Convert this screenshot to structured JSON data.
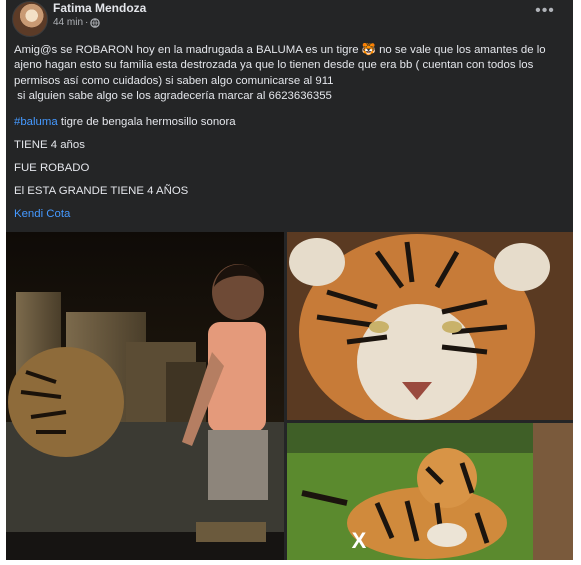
{
  "post": {
    "author": "Fatima Mendoza",
    "time": "44 min",
    "separator": "·",
    "more_label": "•••",
    "body": "Amig@s se ROBARON hoy en la madrugada a BALUMA es un tigre 🐯 no se vale que los amantes de lo ajeno hagan esto su familia esta destrozada ya que lo tienen desde que era bb ( cuentan con todos los permisos así como cuidados) si saben algo comunicarse al 911",
    "body2": " si alguien sabe algo se los agradecería marcar al 6623636355",
    "hashtag": "#baluma",
    "hashtag_rest": " tigre de bengala hermosillo sonora",
    "line_age": "TIENE 4 años",
    "line_stolen": "FUE ROBADO",
    "line_big": "El ESTA GRANDE TIENE 4 AÑOS",
    "mention": "Kendi Cota"
  },
  "overlay": {
    "close_label": "X"
  },
  "icons": {
    "privacy": "globe-icon",
    "menu": "more-options-icon",
    "close": "close-icon"
  },
  "colors": {
    "card_bg": "#242526",
    "text": "#e4e6eb",
    "secondary": "#b0b3b8",
    "link": "#4599ff"
  }
}
